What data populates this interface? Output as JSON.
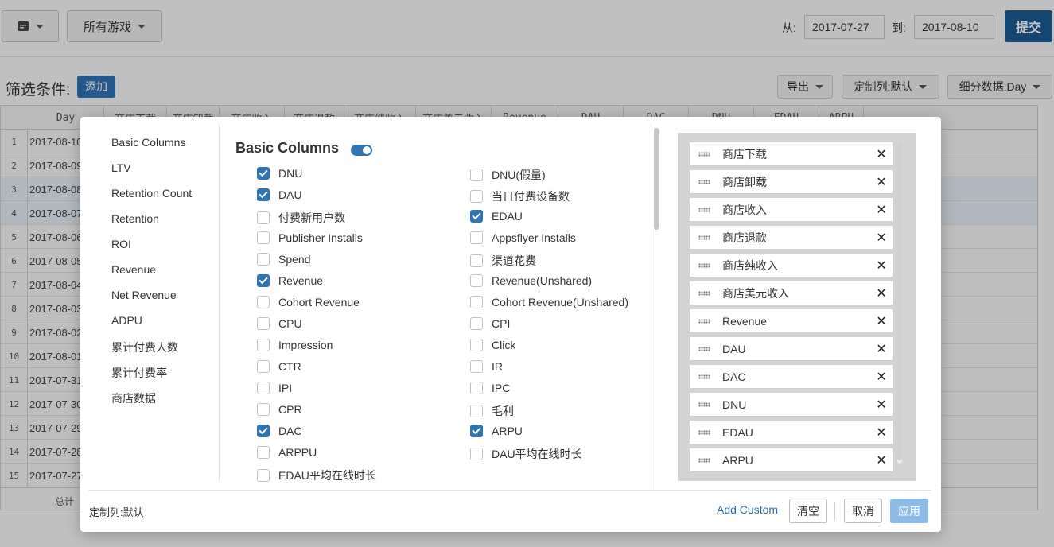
{
  "topbar": {
    "menu_icon": "card-icon",
    "game_select": "所有游戏",
    "from_label": "从:",
    "from_date": "2017-07-27",
    "to_label": "到:",
    "to_date": "2017-08-10",
    "submit_label": "提交"
  },
  "filter": {
    "label": "筛选条件:",
    "add_label": "添加",
    "export_label": "导出",
    "custom_cols_label": "定制列:默认",
    "detail_label": "细分数据:Day"
  },
  "grid": {
    "headers": [
      "Day",
      "商店下载",
      "商店卸载",
      "商店收入",
      "商店退款",
      "商店纯收入",
      "商店美元收入",
      "Revenue",
      "DAU",
      "DAC",
      "DNU",
      "EDAU",
      "ARPU"
    ],
    "rows": [
      {
        "n": "1",
        "day": "2017-08-10"
      },
      {
        "n": "2",
        "day": "2017-08-09"
      },
      {
        "n": "3",
        "day": "2017-08-08"
      },
      {
        "n": "4",
        "day": "2017-08-07"
      },
      {
        "n": "5",
        "day": "2017-08-06"
      },
      {
        "n": "6",
        "day": "2017-08-05"
      },
      {
        "n": "7",
        "day": "2017-08-04"
      },
      {
        "n": "8",
        "day": "2017-08-03"
      },
      {
        "n": "9",
        "day": "2017-08-02"
      },
      {
        "n": "10",
        "day": "2017-08-01"
      },
      {
        "n": "11",
        "day": "2017-07-31"
      },
      {
        "n": "12",
        "day": "2017-07-30"
      },
      {
        "n": "13",
        "day": "2017-07-29"
      },
      {
        "n": "14",
        "day": "2017-07-28"
      },
      {
        "n": "15",
        "day": "2017-07-27"
      }
    ],
    "total_label": "总计"
  },
  "modal": {
    "categories": [
      "Basic Columns",
      "LTV",
      "Retention Count",
      "Retention",
      "ROI",
      "Revenue",
      "Net Revenue",
      "ADPU",
      "累计付费人数",
      "累计付费率",
      "商店数据"
    ],
    "section_title": "Basic Columns",
    "section_toggle_on": true,
    "left_options": [
      {
        "label": "DNU",
        "checked": true
      },
      {
        "label": "DAU",
        "checked": true
      },
      {
        "label": "付费新用户数",
        "checked": false
      },
      {
        "label": "Publisher Installs",
        "checked": false
      },
      {
        "label": "Spend",
        "checked": false
      },
      {
        "label": "Revenue",
        "checked": true
      },
      {
        "label": "Cohort Revenue",
        "checked": false
      },
      {
        "label": "CPU",
        "checked": false
      },
      {
        "label": "Impression",
        "checked": false
      },
      {
        "label": "CTR",
        "checked": false
      },
      {
        "label": "IPI",
        "checked": false
      },
      {
        "label": "CPR",
        "checked": false
      },
      {
        "label": "DAC",
        "checked": true
      },
      {
        "label": "ARPPU",
        "checked": false
      },
      {
        "label": "EDAU平均在线时长",
        "checked": false
      }
    ],
    "right_options": [
      {
        "label": "DNU(假量)",
        "checked": false
      },
      {
        "label": "当日付费设备数",
        "checked": false
      },
      {
        "label": "EDAU",
        "checked": true
      },
      {
        "label": "Appsflyer Installs",
        "checked": false
      },
      {
        "label": "渠道花费",
        "checked": false
      },
      {
        "label": "Revenue(Unshared)",
        "checked": false
      },
      {
        "label": "Cohort Revenue(Unshared)",
        "checked": false
      },
      {
        "label": "CPI",
        "checked": false
      },
      {
        "label": "Click",
        "checked": false
      },
      {
        "label": "IR",
        "checked": false
      },
      {
        "label": "IPC",
        "checked": false
      },
      {
        "label": "毛利",
        "checked": false
      },
      {
        "label": "ARPU",
        "checked": true
      },
      {
        "label": "DAU平均在线时长",
        "checked": false
      }
    ],
    "selected_columns": [
      "商店下载",
      "商店卸载",
      "商店收入",
      "商店退款",
      "商店纯收入",
      "商店美元收入",
      "Revenue",
      "DAU",
      "DAC",
      "DNU",
      "EDAU",
      "ARPU"
    ],
    "remove_glyph": "✕",
    "footer": {
      "custom_label": "定制列:默认",
      "add_custom": "Add Custom",
      "clear_label": "清空",
      "cancel_label": "取消",
      "apply_label": "应用"
    }
  }
}
